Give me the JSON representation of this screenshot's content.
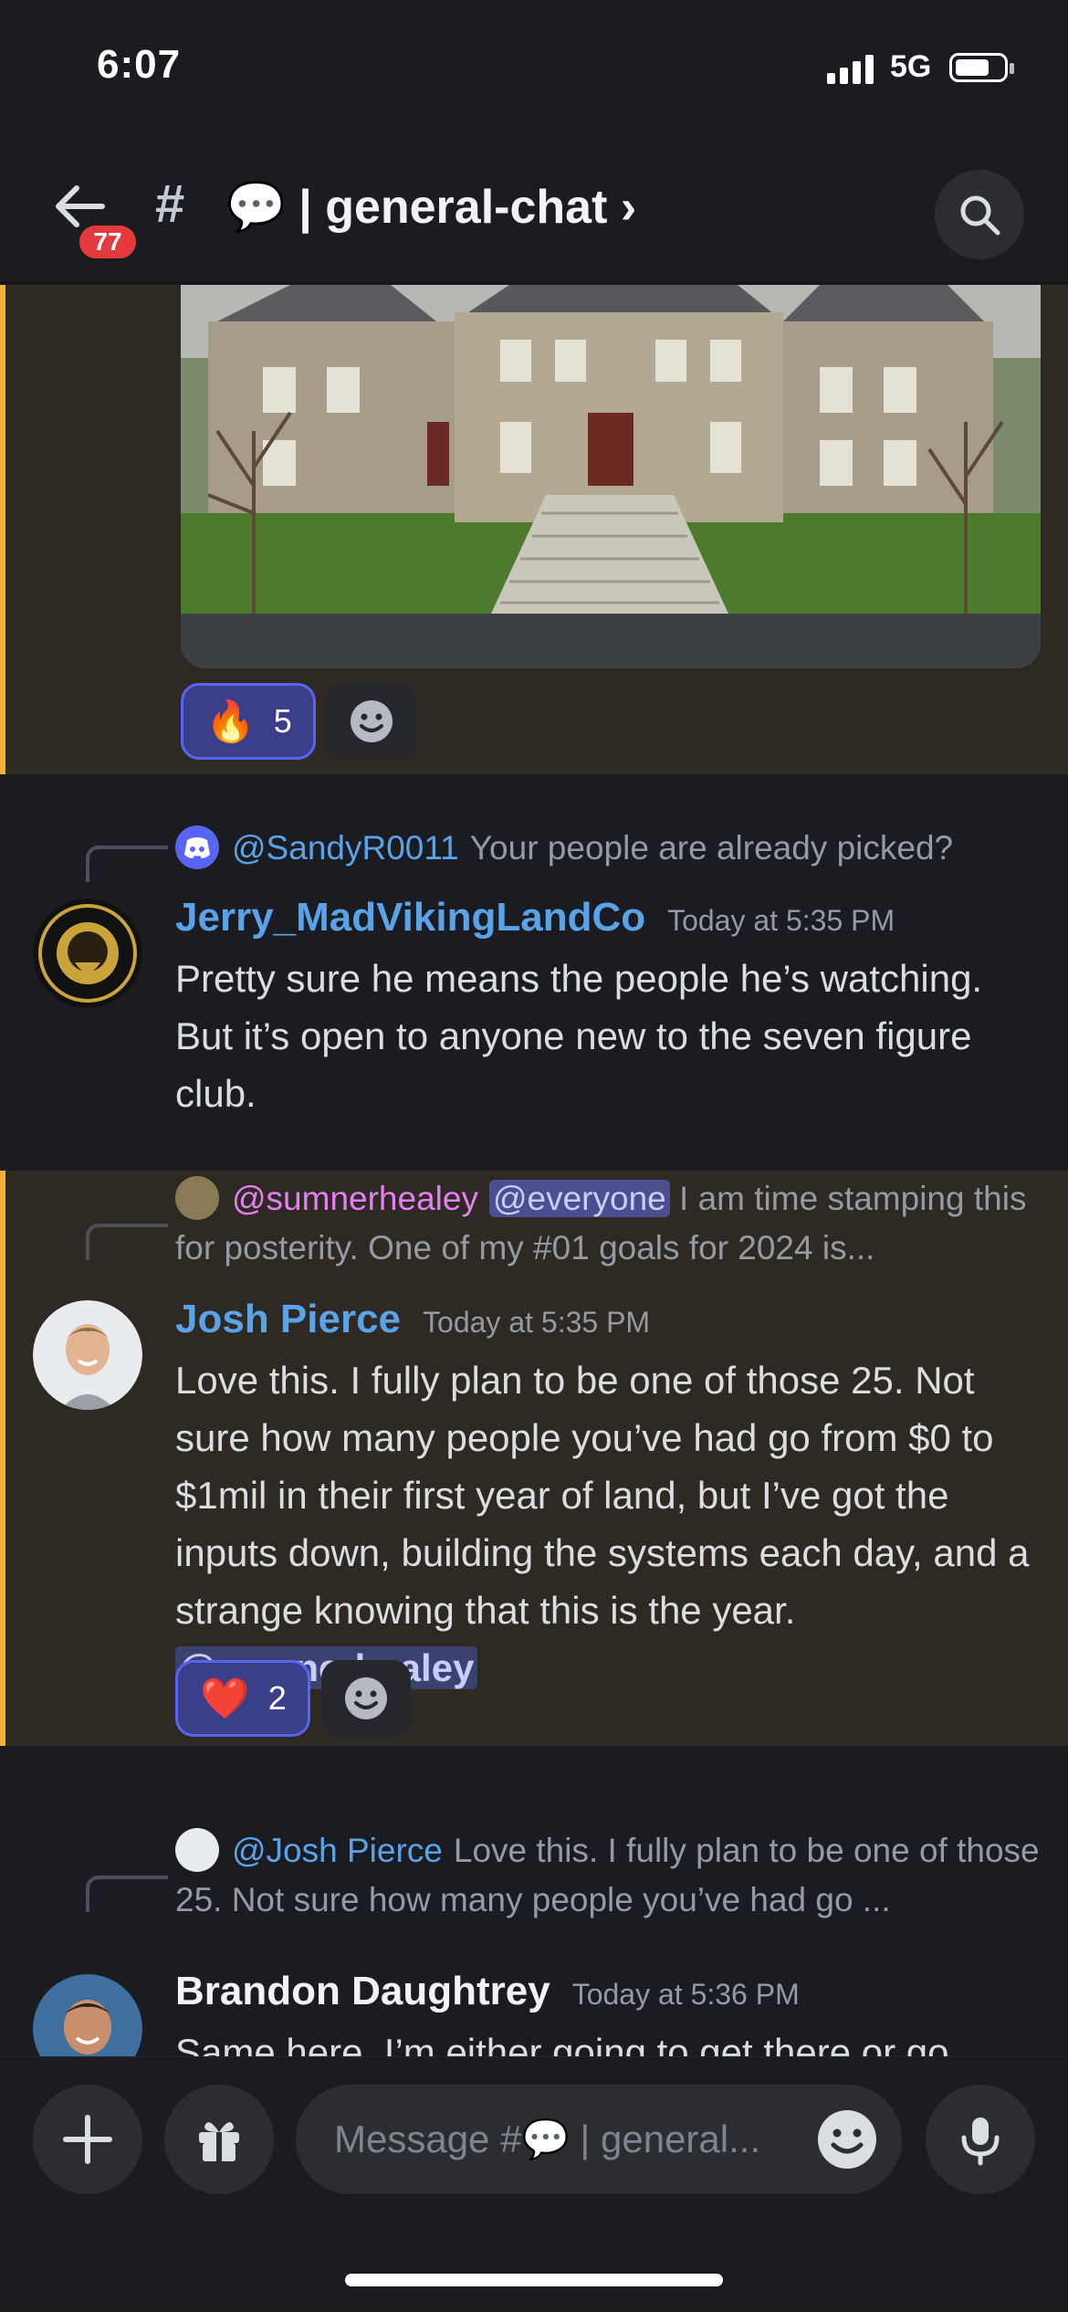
{
  "status_bar": {
    "time": "6:07",
    "network": "5G"
  },
  "header": {
    "unread_badge": "77",
    "thread_icon": "#",
    "channel_name": "💬 | general-chat ›"
  },
  "messages": [
    {
      "reactions": [
        {
          "emoji": "🔥",
          "count": "5"
        }
      ]
    },
    {
      "reply_to": {
        "name": "@SandyR0011",
        "text": "Your people are already picked?"
      },
      "author": "Jerry_MadVikingLandCo",
      "author_color": "#5aa3e8",
      "timestamp": "Today at 5:35 PM",
      "text": "Pretty sure he means the people he’s watching.  But it’s open to anyone new to the seven figure club."
    },
    {
      "reply_to": {
        "name": "@sumnerhealey",
        "mention": "@everyone",
        "text": "I am time stamping this for posterity.   One of my #01 goals for 2024 is..."
      },
      "author": "Josh Pierce",
      "author_color": "#5aa3e8",
      "timestamp": "Today at 5:35 PM",
      "text": "Love this. I fully plan to be one of those 25. Not sure how many people you’ve had go from $0 to $1mil in their first year of land, but I’ve got the inputs down, building the systems each day, and a strange knowing that this is the year.",
      "mention": "@sumnerhealey",
      "reactions": [
        {
          "emoji": "❤️",
          "count": "2"
        }
      ]
    },
    {
      "reply_to": {
        "name": "@Josh Pierce",
        "text": "Love this. I fully plan to be one of those 25. Not sure how many people you’ve had go ..."
      },
      "author": "Brandon Daughtrey",
      "author_color": "#f2f3f5",
      "timestamp": "Today at 5:36 PM",
      "text": "Same here. I’m either going to get there or go"
    }
  ],
  "composer": {
    "placeholder": "Message #💬 | general..."
  },
  "colors": {
    "accent": "#5865f2",
    "highlight_bar": "#f0b232",
    "badge": "#e53a3d",
    "mention": "#c9cdfb"
  },
  "icons": [
    "back-arrow-icon",
    "search-icon",
    "plus-icon",
    "gift-icon",
    "emoji-icon",
    "microphone-icon",
    "add-reaction-icon",
    "discord-logo-icon"
  ]
}
